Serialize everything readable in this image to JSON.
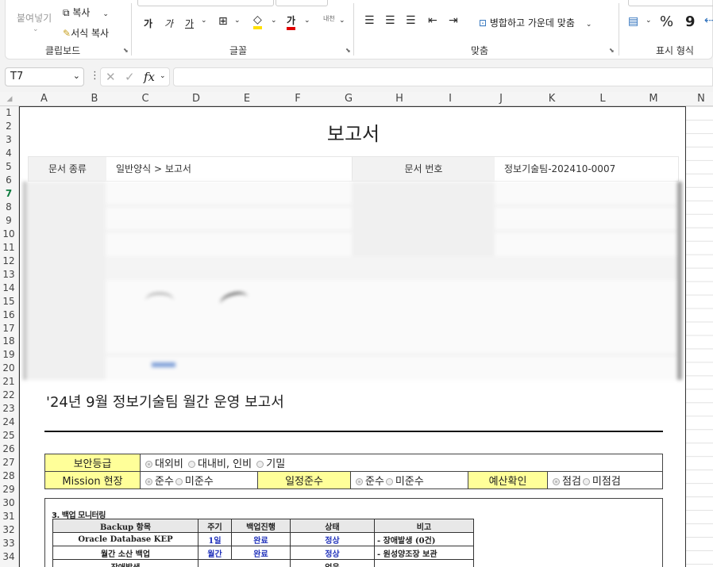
{
  "ribbon": {
    "clipboard": {
      "paste": "붙여넣기",
      "copy": "복사",
      "format_painter": "서식 복사",
      "group": "클립보드"
    },
    "font": {
      "group": "글꼴",
      "bold": "가",
      "italic": "가",
      "underline": "가",
      "color_letter": "가",
      "phonetic": "내천"
    },
    "align": {
      "group": "맞춤",
      "merge": "병합하고 가운데 맞춤"
    },
    "number": {
      "group": "표시 형식",
      "percent": "%",
      "comma": "9"
    }
  },
  "formula_bar": {
    "name_box": "T7",
    "fx": "fx",
    "value": ""
  },
  "columns": [
    "A",
    "B",
    "C",
    "D",
    "E",
    "F",
    "G",
    "H",
    "I",
    "J",
    "K",
    "L",
    "M",
    "N"
  ],
  "rows": [
    "1",
    "2",
    "3",
    "4",
    "5",
    "6",
    "7",
    "8",
    "9",
    "10",
    "11",
    "12",
    "13",
    "14",
    "15",
    "16",
    "17",
    "18",
    "19",
    "20",
    "21",
    "22",
    "23",
    "24",
    "25",
    "26",
    "27",
    "28",
    "29",
    "30",
    "31",
    "32",
    "33",
    "34"
  ],
  "doc": {
    "title": "보고서",
    "doc_type_label": "문서 종류",
    "doc_type_value": "일반양식 > 보고서",
    "doc_no_label": "문서 번호",
    "doc_no_value": "정보기술팀-202410-0007",
    "report_title": "'24년 9월 정보기술팀 월간 운영 보고서",
    "security": {
      "label": "보안등급",
      "opt1": "대외비",
      "opt2": "대내비, 인비",
      "opt3": "기밀"
    },
    "mission": {
      "label": "Mission 현장",
      "opt1": "준수",
      "opt2": "미준수"
    },
    "schedule": {
      "label": "일정준수",
      "opt1": "준수",
      "opt2": "미준수"
    },
    "budget": {
      "label": "예산확인",
      "opt1": "점검",
      "opt2": "미점검"
    },
    "backup": {
      "heading": "3. 백업 모니터링",
      "headers": [
        "Backup 항목",
        "주기",
        "백업진행",
        "상태",
        "비고"
      ],
      "rows": [
        [
          "Oracle Database KEP",
          "1일",
          "완료",
          "정상",
          "- 장애발생 (0건)"
        ],
        [
          "월간 소산 백업",
          "월간",
          "완료",
          "정상",
          "- 원성양조장 보관"
        ],
        [
          "장애발생",
          "",
          "",
          "없음",
          ""
        ]
      ]
    }
  }
}
